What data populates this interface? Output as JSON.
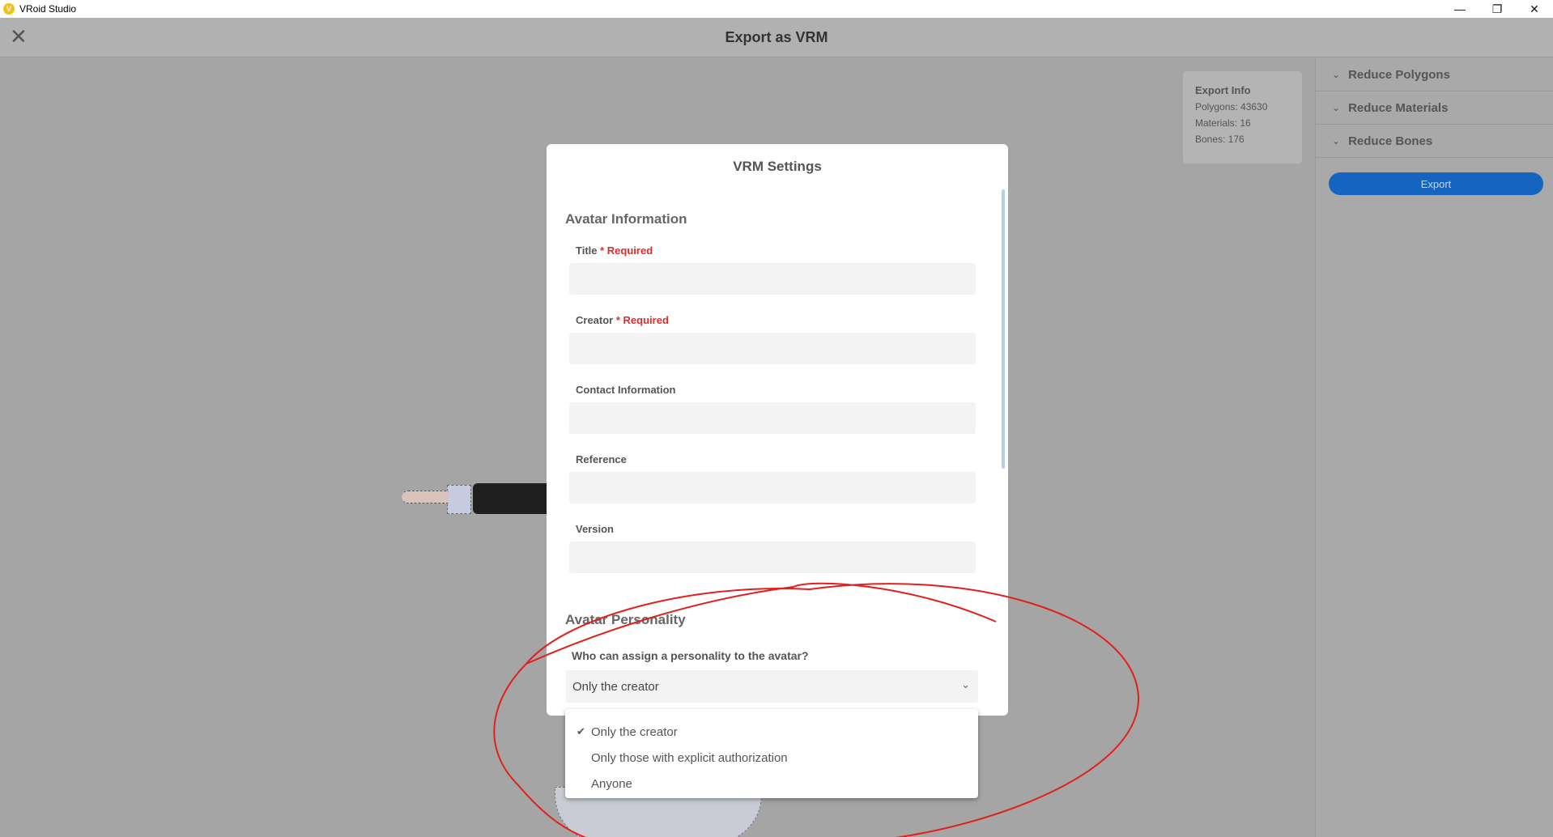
{
  "window": {
    "app_title": "VRoid Studio",
    "logo_glyph": "V",
    "minimize_glyph": "—",
    "restore_glyph": "❐",
    "close_glyph": "✕"
  },
  "header": {
    "close_glyph": "✕",
    "title": "Export as VRM"
  },
  "export_info": {
    "title": "Export Info",
    "polygons": "Polygons: 43630",
    "materials": "Materials: 16",
    "bones": "Bones: 176"
  },
  "right_panel": {
    "chevron_glyph": "⌄",
    "items": [
      {
        "label": "Reduce Polygons"
      },
      {
        "label": "Reduce Materials"
      },
      {
        "label": "Reduce Bones"
      }
    ],
    "export_label": "Export"
  },
  "dialog": {
    "title": "VRM Settings",
    "avatar_information": "Avatar Information",
    "required_text": "* Required",
    "fields": {
      "title": "Title",
      "creator": "Creator",
      "contact": "Contact Information",
      "reference": "Reference",
      "version": "Version"
    },
    "avatar_personality": "Avatar Personality",
    "question": "Who can assign a personality to the avatar?",
    "selected_value": "Only the creator",
    "select_chevron": "⌄"
  },
  "dropdown": {
    "check_glyph": "✔",
    "options": [
      {
        "label": "Only the creator"
      },
      {
        "label": "Only those with explicit authorization"
      },
      {
        "label": "Anyone"
      }
    ]
  },
  "colors": {
    "accent": "#1565c0",
    "required": "#e02b2b",
    "annotation": "#e0201c"
  }
}
